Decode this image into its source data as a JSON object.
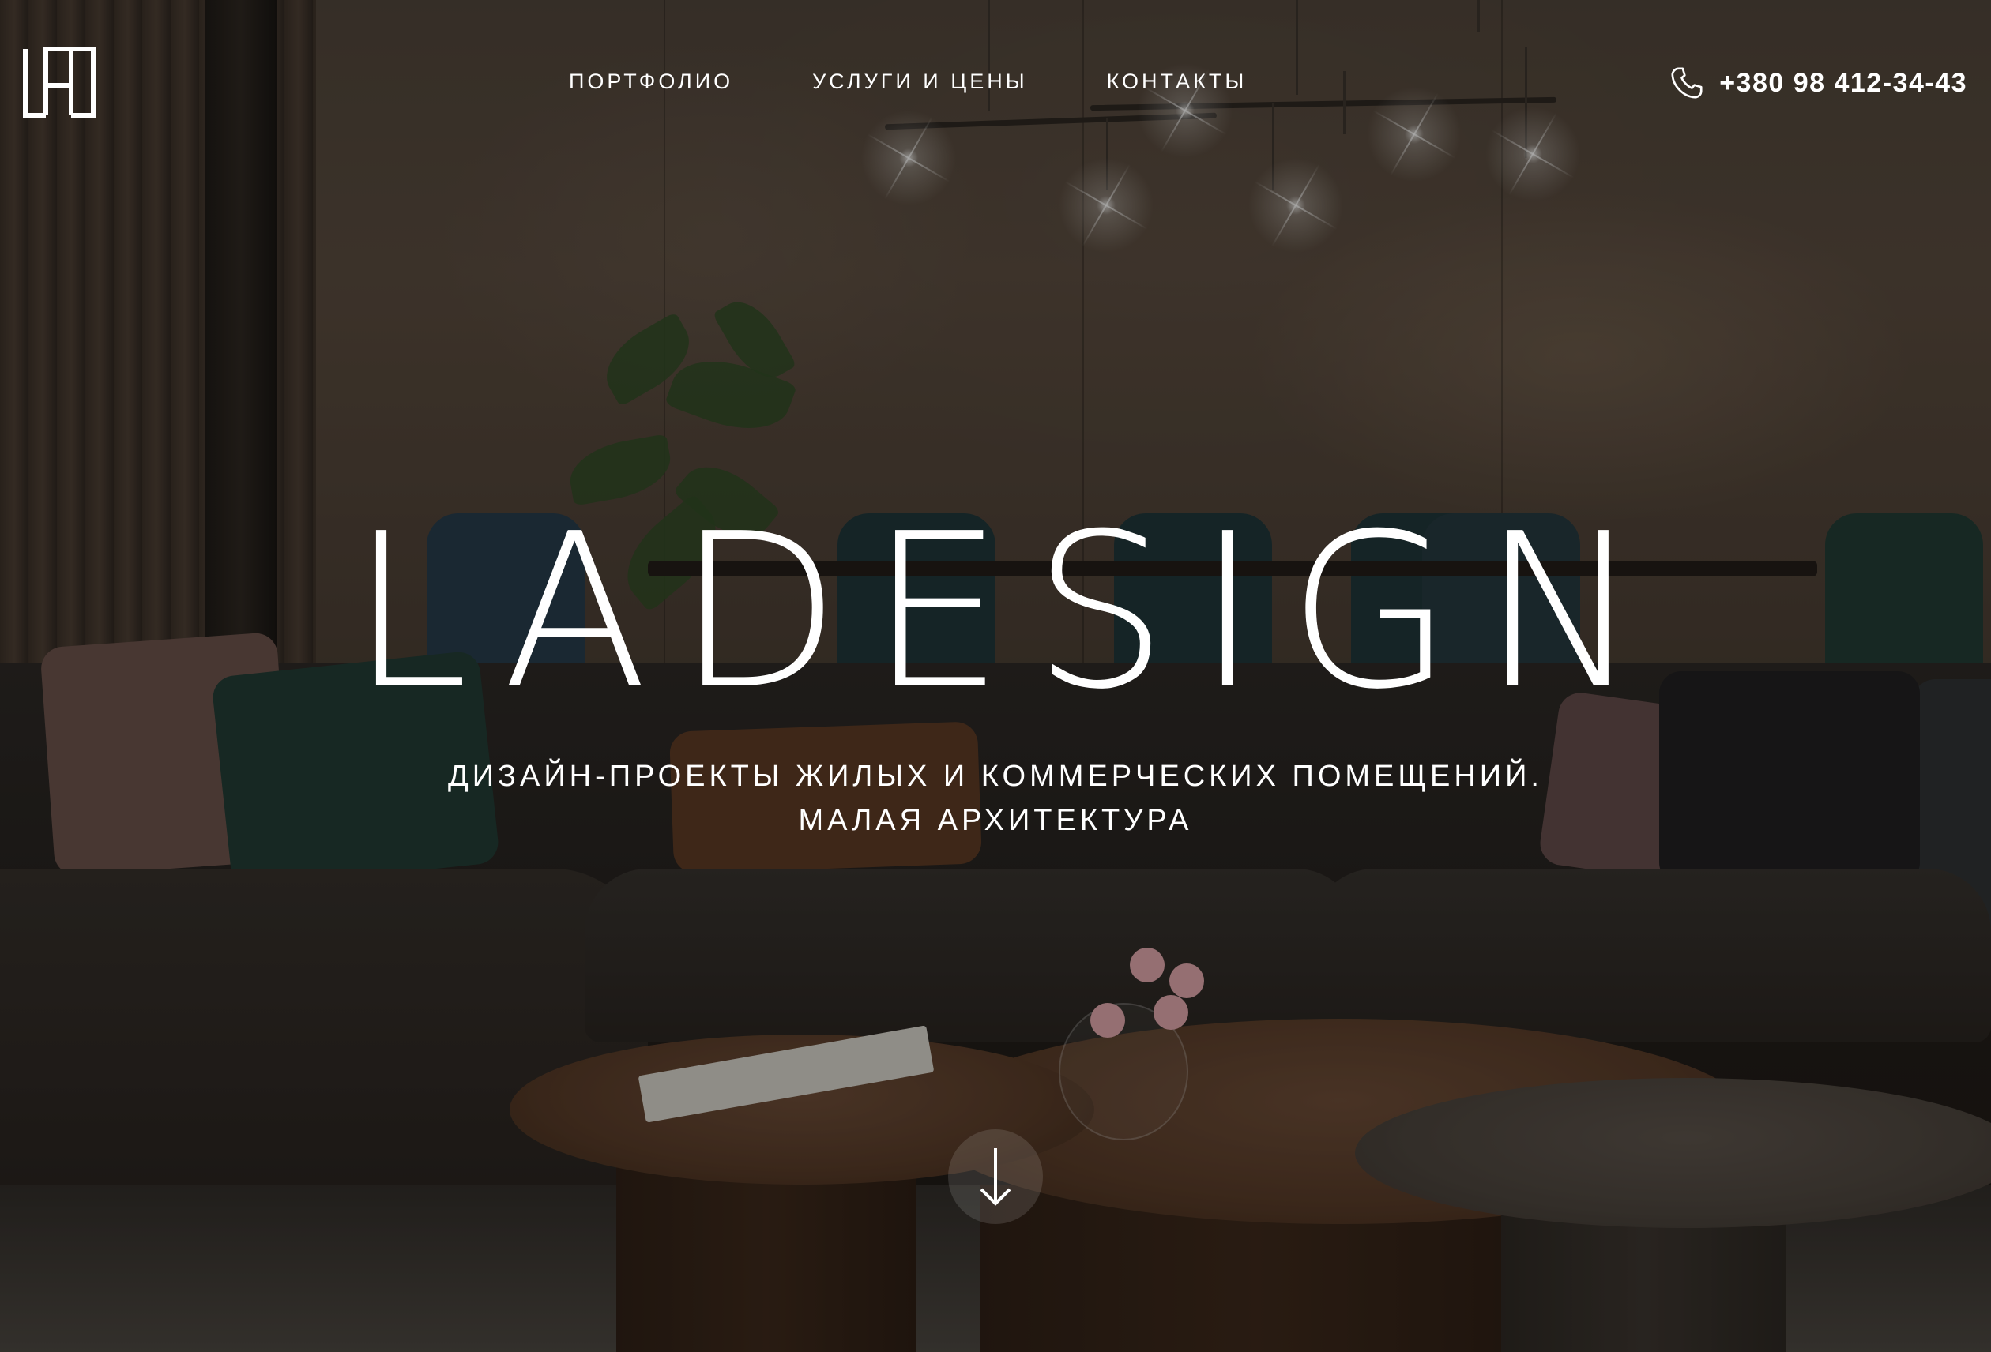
{
  "nav": {
    "items": [
      {
        "label": "ПОРТФОЛИО"
      },
      {
        "label": "УСЛУГИ И ЦЕНЫ"
      },
      {
        "label": "КОНТАКТЫ"
      }
    ]
  },
  "phone": {
    "number": "+380 98 412-34-43",
    "icon": "phone-icon"
  },
  "hero": {
    "title": "LADESIGN",
    "subtitle_line1": "ДИЗАЙН-ПРОЕКТЫ ЖИЛЫХ И КОММЕРЧЕСКИХ ПОМЕЩЕНИЙ.",
    "subtitle_line2": "МАЛАЯ АРХИТЕКТУРА",
    "scroll_icon": "arrow-down-icon"
  },
  "colors": {
    "text": "#ffffff",
    "overlay": "#0a0807"
  }
}
